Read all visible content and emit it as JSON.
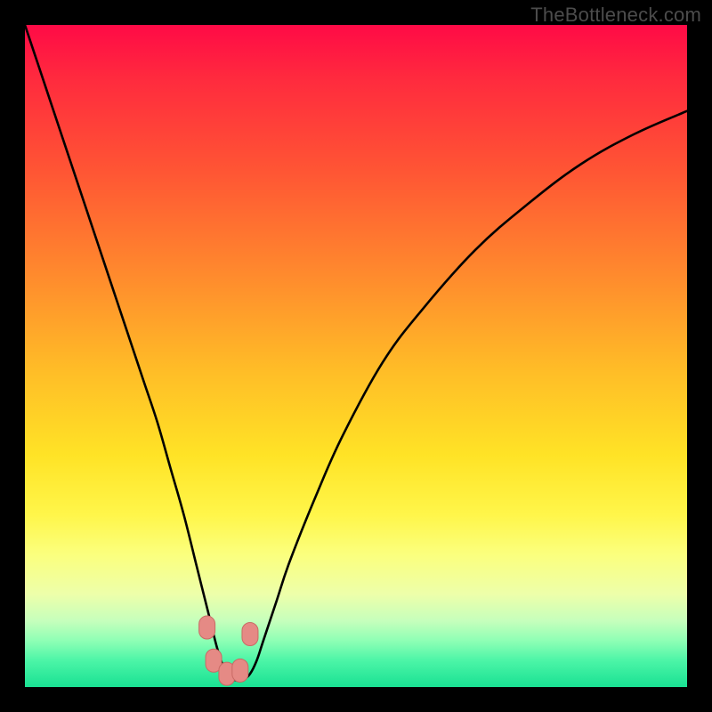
{
  "watermark": "TheBottleneck.com",
  "colors": {
    "gradient_top": "#ff0a46",
    "gradient_bottom": "#19e193",
    "curve_stroke": "#000000",
    "marker_fill": "#e58a85",
    "marker_stroke": "#c96a65"
  },
  "chart_data": {
    "type": "line",
    "title": "",
    "xlabel": "",
    "ylabel": "",
    "xlim": [
      0,
      100
    ],
    "ylim": [
      0,
      100
    ],
    "x": [
      0,
      2,
      4,
      6,
      8,
      10,
      12,
      14,
      16,
      18,
      20,
      22,
      24,
      26,
      27,
      28,
      29,
      30,
      31,
      32,
      33,
      34,
      35,
      36,
      38,
      40,
      44,
      48,
      54,
      60,
      68,
      76,
      84,
      92,
      100
    ],
    "values": [
      100,
      94,
      88,
      82,
      76,
      70,
      64,
      58,
      52,
      46,
      40,
      33,
      26,
      18,
      14,
      10,
      6,
      3,
      1.5,
      1,
      1.2,
      2,
      4,
      7,
      13,
      19,
      29,
      38,
      49,
      57,
      66,
      73,
      79,
      83.5,
      87
    ],
    "annotations": [
      {
        "x": 27.5,
        "y": 9,
        "label": ""
      },
      {
        "x": 28.5,
        "y": 4,
        "label": ""
      },
      {
        "x": 30.5,
        "y": 2,
        "label": ""
      },
      {
        "x": 32.5,
        "y": 2.5,
        "label": ""
      },
      {
        "x": 34,
        "y": 8,
        "label": ""
      }
    ]
  }
}
